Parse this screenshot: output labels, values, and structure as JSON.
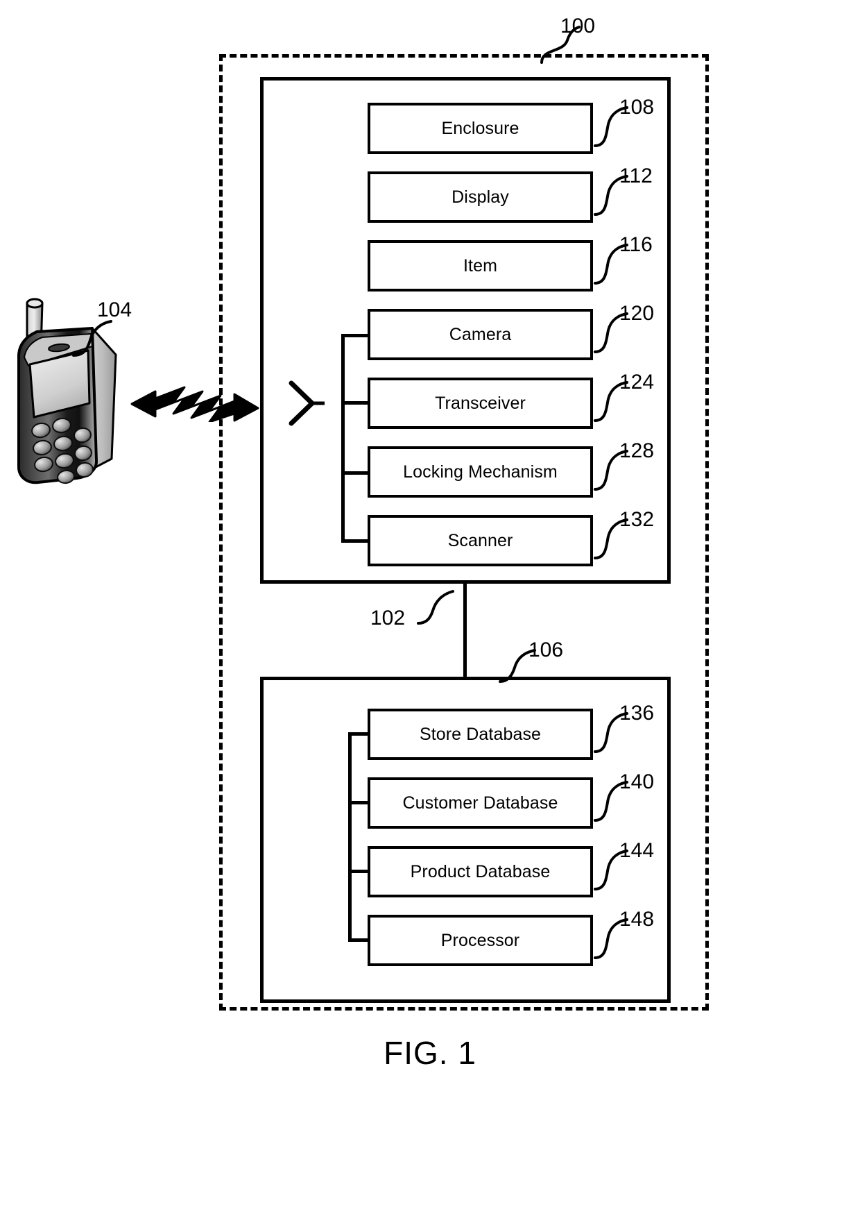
{
  "figure": {
    "caption": "FIG. 1",
    "system_label": "100",
    "mobile_device_label": "104",
    "enclosure_unit_label": "102",
    "server_unit_label": "106"
  },
  "upper_unit": {
    "ref": "102",
    "components": [
      {
        "label": "Enclosure",
        "ref": "108",
        "bussed": false
      },
      {
        "label": "Display",
        "ref": "112",
        "bussed": false
      },
      {
        "label": "Item",
        "ref": "116",
        "bussed": false
      },
      {
        "label": "Camera",
        "ref": "120",
        "bussed": true
      },
      {
        "label": "Transceiver",
        "ref": "124",
        "bussed": true
      },
      {
        "label": "Locking Mechanism",
        "ref": "128",
        "bussed": true
      },
      {
        "label": "Scanner",
        "ref": "132",
        "bussed": true
      }
    ]
  },
  "lower_unit": {
    "ref": "106",
    "components": [
      {
        "label": "Store Database",
        "ref": "136"
      },
      {
        "label": "Customer Database",
        "ref": "140"
      },
      {
        "label": "Product Database",
        "ref": "144"
      },
      {
        "label": "Processor",
        "ref": "148"
      }
    ]
  },
  "mobile_device": {
    "ref": "104",
    "kind": "mobile-phone-illustration"
  },
  "link": {
    "kind": "wireless-bidirectional-zigzag-arrow"
  },
  "antenna": {
    "kind": "antenna-symbol"
  },
  "colors": {
    "line": "#000000",
    "background": "#ffffff"
  }
}
